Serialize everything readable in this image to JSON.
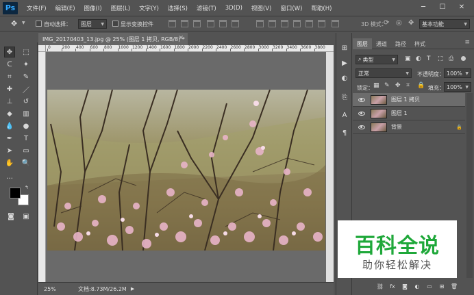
{
  "app": {
    "logo": "Ps",
    "menu": [
      "文件(F)",
      "编辑(E)",
      "图像(I)",
      "图层(L)",
      "文字(Y)",
      "选择(S)",
      "滤镜(T)",
      "3D(D)",
      "视图(V)",
      "窗口(W)",
      "帮助(H)"
    ]
  },
  "options": {
    "auto_select_label": "自动选择：",
    "auto_select_value": "图层",
    "show_transform_label": "显示变换控件",
    "mode3d_label": "3D 模式：",
    "workspace": "基本功能"
  },
  "document": {
    "tab_title": "IMG_20170403_13.jpg @ 25% (图层 1 拷贝, RGB/8) *",
    "ruler_ticks": [
      "0",
      "200",
      "400",
      "600",
      "800",
      "1000",
      "1200",
      "1400",
      "1600",
      "1800",
      "2000",
      "2200",
      "2400",
      "2600",
      "2800",
      "3000",
      "3200",
      "3400",
      "3600",
      "3800",
      "4000"
    ],
    "zoom": "25%",
    "doc_size": "文档:8.73M/26.2M"
  },
  "panel": {
    "tabs": [
      "图层",
      "通道",
      "路径",
      "样式"
    ],
    "kind_label": "类型",
    "blend_mode": "正常",
    "opacity_label": "不透明度：",
    "opacity_value": "100%",
    "lock_label": "锁定：",
    "fill_label": "填充：",
    "fill_value": "100%",
    "layers": [
      {
        "name": "图层 1 拷贝",
        "selected": true,
        "locked": false
      },
      {
        "name": "图层 1",
        "selected": false,
        "locked": false
      },
      {
        "name": "背景",
        "selected": false,
        "locked": true
      }
    ]
  },
  "watermark": {
    "title": "百科全说",
    "subtitle": "助你轻松解决"
  },
  "colors": {
    "ui_bg": "#535353",
    "accent": "#31a8ff",
    "watermark_green": "#1fa83a"
  }
}
